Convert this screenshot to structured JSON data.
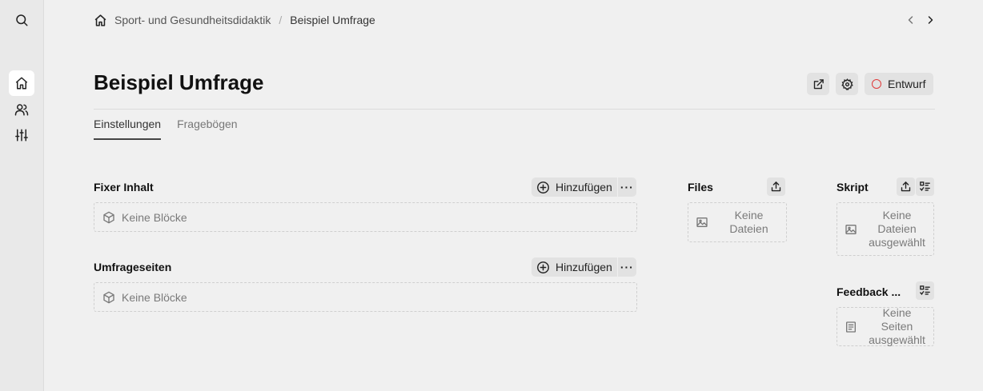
{
  "breadcrumb": {
    "items": [
      "Sport- und Gesundheitsdidaktik",
      "Beispiel Umfrage"
    ],
    "separator": "/"
  },
  "page": {
    "title": "Beispiel Umfrage"
  },
  "status": {
    "label": "Entwurf",
    "color": "#e03a3a"
  },
  "tabs": [
    {
      "label": "Einstellungen",
      "active": true
    },
    {
      "label": "Fragebögen",
      "active": false
    }
  ],
  "sections": {
    "fixed": {
      "label": "Fixer Inhalt",
      "add_label": "Hinzufügen",
      "more_label": "···",
      "empty_label": "Keine Blöcke"
    },
    "pages": {
      "label": "Umfrageseiten",
      "add_label": "Hinzufügen",
      "more_label": "···",
      "empty_label": "Keine Blöcke"
    },
    "files": {
      "label": "Files",
      "empty_label": "Keine Dateien"
    },
    "script": {
      "label": "Skript",
      "empty_label": "Keine Dateien ausgewählt"
    },
    "feedback": {
      "label": "Feedback ...",
      "empty_label": "Keine Seiten ausgewählt"
    }
  },
  "icons": {
    "sidebar": [
      "search-icon",
      "home-icon",
      "users-icon",
      "sliders-icon"
    ],
    "header": [
      "external-link-icon",
      "gear-icon"
    ]
  }
}
